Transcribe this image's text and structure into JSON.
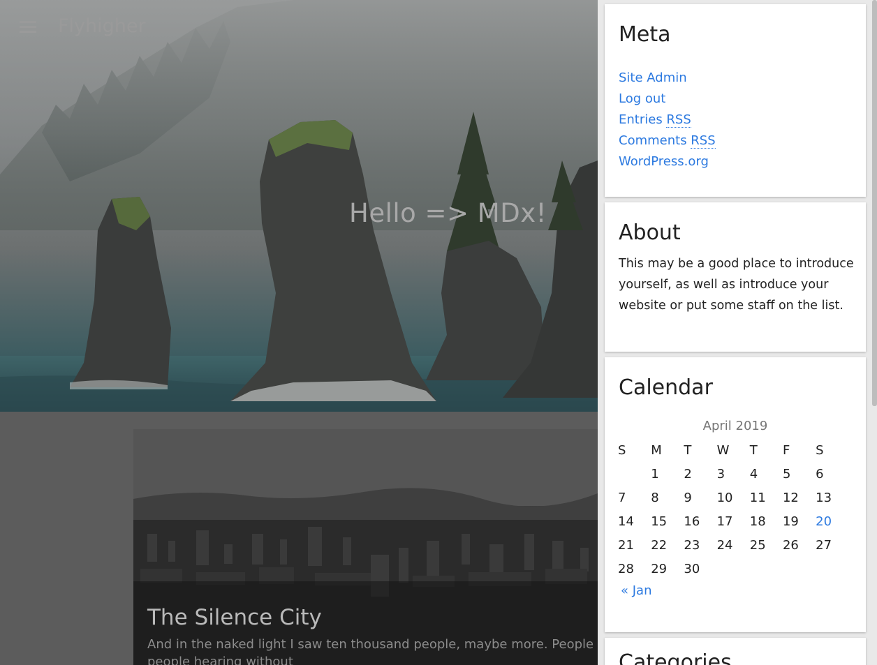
{
  "header": {
    "site_title": "Flyhigher",
    "menu_icon": "hamburger-menu-icon"
  },
  "hero": {
    "headline": "Hello => MDx!"
  },
  "post": {
    "title": "The Silence City",
    "excerpt": "And in the naked light I saw ten thousand people, maybe more. People talking without speaking,",
    "excerpt_line2": "people hearing without"
  },
  "sidebar": {
    "meta": {
      "title": "Meta",
      "links": [
        {
          "label": "Site Admin"
        },
        {
          "label": "Log out"
        },
        {
          "label_prefix": "Entries ",
          "label_abbr": "RSS"
        },
        {
          "label_prefix": "Comments ",
          "label_abbr": "RSS"
        },
        {
          "label": "WordPress.org"
        }
      ]
    },
    "about": {
      "title": "About",
      "text": "This may be a good place to introduce yourself, as well as introduce your website or put some staff on the list."
    },
    "calendar": {
      "title": "Calendar",
      "caption": "April 2019",
      "weekdays": [
        "S",
        "M",
        "T",
        "W",
        "T",
        "F",
        "S"
      ],
      "weeks": [
        [
          "",
          "1",
          "2",
          "3",
          "4",
          "5",
          "6"
        ],
        [
          "7",
          "8",
          "9",
          "10",
          "11",
          "12",
          "13"
        ],
        [
          "14",
          "15",
          "16",
          "17",
          "18",
          "19",
          "20"
        ],
        [
          "21",
          "22",
          "23",
          "24",
          "25",
          "26",
          "27"
        ],
        [
          "28",
          "29",
          "30",
          "",
          "",
          "",
          ""
        ]
      ],
      "linked_day": "20",
      "prev_link": "« Jan"
    },
    "categories": {
      "title": "Categories"
    }
  },
  "colors": {
    "link": "#2d7ae0",
    "sidebar_bg": "#e9e9e9",
    "overlay": "#5c5c5c"
  }
}
